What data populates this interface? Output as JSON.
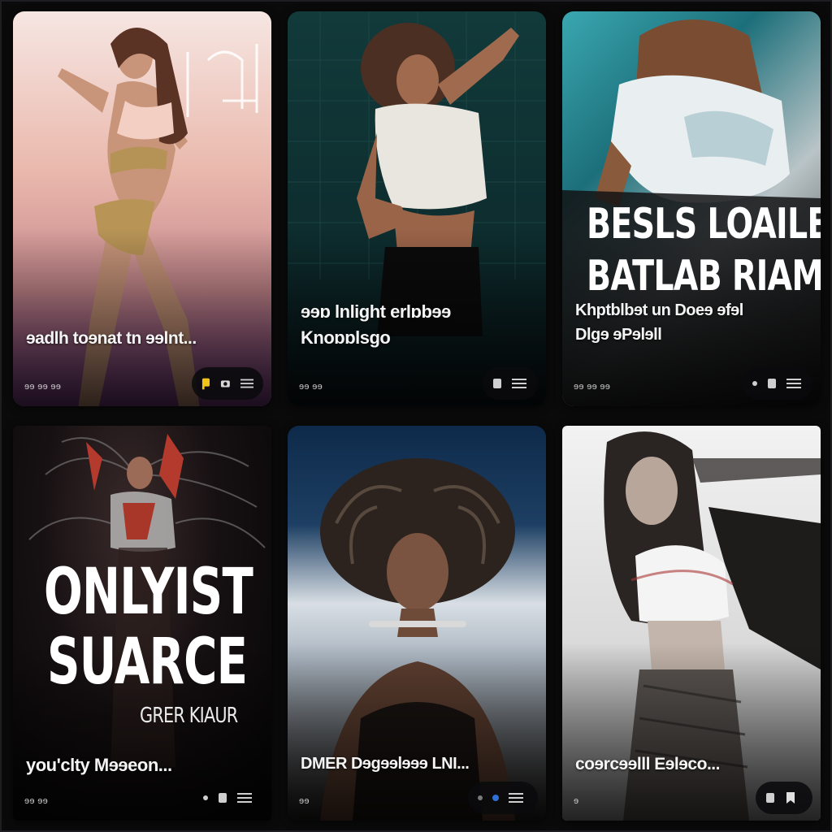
{
  "cards": [
    {
      "caption": "ɘadlh toɘnat tn ɘɘlnt...",
      "meta": "ɘɘ ɘɘ ɘɘ",
      "accent": "#f2c418"
    },
    {
      "caption_line1": "ɘɘɒ lnlight erlɒbɘɘ",
      "caption_line2": "Knoɒɒlsgo",
      "meta": "ɘɘ ɘɘ"
    },
    {
      "headline_line1": "BESLS LOAILE",
      "headline_line2": "BATLAB RIAM",
      "caption_line1": "Khptblbɘt un Doeɘ ɘfɘl",
      "caption_line2": "Dlgɘ ɘPɘlɘll",
      "meta": "ɘɘ ɘɘ ɘɘ"
    },
    {
      "headline_line1": "ONLYIST",
      "headline_line2": "SUARCE",
      "subheadline": "GRER KIAUR",
      "caption": "you'clty Mɘɘeon...",
      "meta": "ɘɘ ɘɘ"
    },
    {
      "caption": "DMER Dɘgɘɘlɘɘɘ LNI...",
      "meta": "ɘɘ",
      "accent": "#2f6fd6"
    },
    {
      "caption": "coɘrcɘɘlll Eɘlɘco...",
      "meta": "ɘ"
    }
  ],
  "icons": {
    "card_1": [
      "flag-icon",
      "camera-icon",
      "menu-icon"
    ],
    "card_2": [
      "square-icon",
      "menu-icon"
    ],
    "card_3": [
      "dot-icon",
      "square-icon",
      "menu-icon"
    ],
    "card_4": [
      "dot-icon",
      "square-icon",
      "menu-icon"
    ],
    "card_5": [
      "dot-icon",
      "dot-icon",
      "menu-icon"
    ],
    "card_6": [
      "square-icon",
      "bookmark-icon"
    ]
  }
}
